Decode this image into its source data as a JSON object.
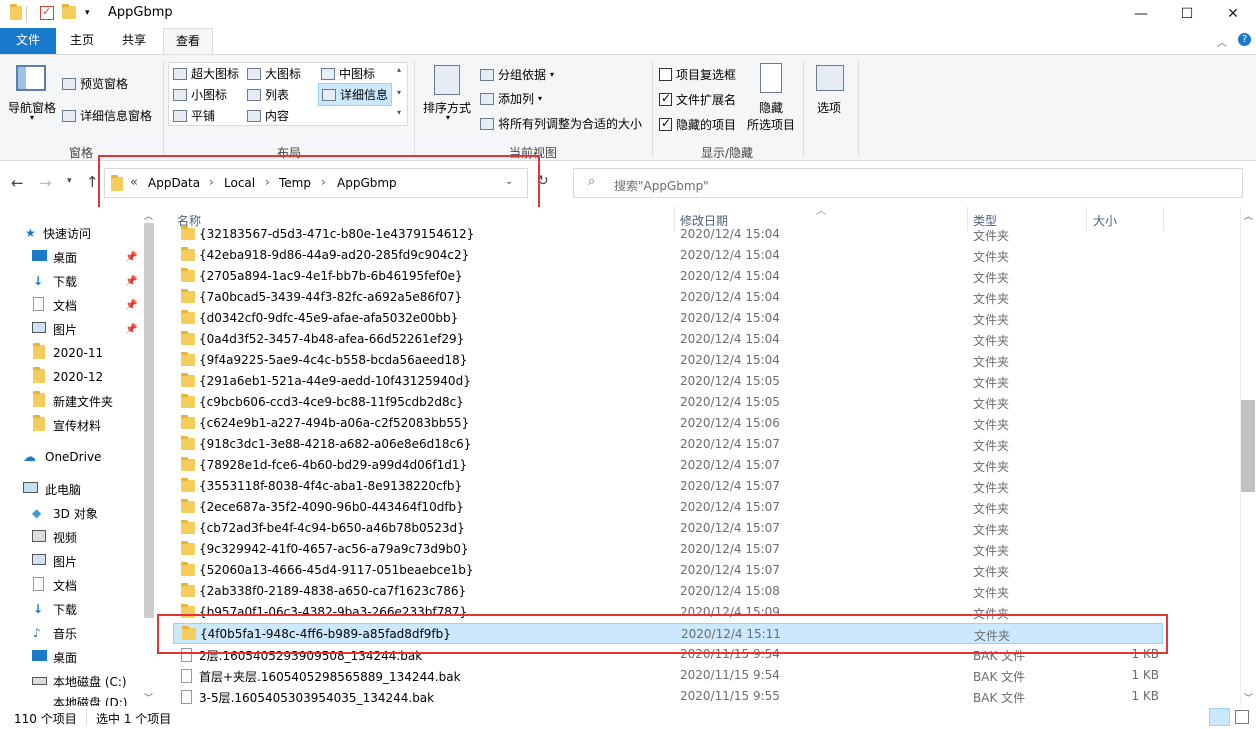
{
  "window": {
    "title": "AppGbmp",
    "minimize": "—",
    "maximize": "☐",
    "close": "✕"
  },
  "tabs": {
    "file": "文件",
    "home": "主页",
    "share": "共享",
    "view": "查看"
  },
  "ribbon": {
    "pane": {
      "nav_pane": "导航窗格",
      "preview": "预览窗格",
      "details": "详细信息窗格",
      "label": "窗格"
    },
    "layout": {
      "xl": "超大图标",
      "large": "大图标",
      "medium": "中图标",
      "small": "小图标",
      "list": "列表",
      "details": "详细信息",
      "tiles": "平铺",
      "content": "内容",
      "label": "布局"
    },
    "current": {
      "sort": "排序方式",
      "group": "分组依据",
      "add_col": "添加列",
      "fit": "将所有列调整为合适的大小",
      "label": "当前视图"
    },
    "showhide": {
      "item_cb": "项目复选框",
      "ext": "文件扩展名",
      "hidden_items": "隐藏的项目",
      "hide": "隐藏",
      "selected": "所选项目",
      "label": "显示/隐藏"
    },
    "options": "选项"
  },
  "address": {
    "chevrons": "«",
    "crumbs": [
      "AppData",
      "Local",
      "Temp",
      "AppGbmp"
    ],
    "search_placeholder": "搜索\"AppGbmp\""
  },
  "nav": {
    "quick": "快速访问",
    "desktop": "桌面",
    "downloads": "下载",
    "docs": "文档",
    "pictures": "图片",
    "f1": "2020-11",
    "f2": "2020-12",
    "f3": "新建文件夹",
    "f4": "宣传材料",
    "onedrive": "OneDrive",
    "pc": "此电脑",
    "obj3d": "3D 对象",
    "videos": "视频",
    "pictures2": "图片",
    "docs2": "文档",
    "downloads2": "下载",
    "music": "音乐",
    "desktop2": "桌面",
    "cdrive": "本地磁盘 (C:)",
    "ddrive": "本地磁盘 (D:)"
  },
  "columns": {
    "name": "名称",
    "date": "修改日期",
    "type": "类型",
    "size": "大小"
  },
  "files": [
    {
      "name": "{32183567-d5d3-471c-b80e-1e4379154612}",
      "date": "2020/12/4 15:04",
      "type": "文件夹",
      "size": "",
      "kind": "folder"
    },
    {
      "name": "{42eba918-9d86-44a9-ad20-285fd9c904c2}",
      "date": "2020/12/4 15:04",
      "type": "文件夹",
      "size": "",
      "kind": "folder"
    },
    {
      "name": "{2705a894-1ac9-4e1f-bb7b-6b46195fef0e}",
      "date": "2020/12/4 15:04",
      "type": "文件夹",
      "size": "",
      "kind": "folder"
    },
    {
      "name": "{7a0bcad5-3439-44f3-82fc-a692a5e86f07}",
      "date": "2020/12/4 15:04",
      "type": "文件夹",
      "size": "",
      "kind": "folder"
    },
    {
      "name": "{d0342cf0-9dfc-45e9-afae-afa5032e00bb}",
      "date": "2020/12/4 15:04",
      "type": "文件夹",
      "size": "",
      "kind": "folder"
    },
    {
      "name": "{0a4d3f52-3457-4b48-afea-66d52261ef29}",
      "date": "2020/12/4 15:04",
      "type": "文件夹",
      "size": "",
      "kind": "folder"
    },
    {
      "name": "{9f4a9225-5ae9-4c4c-b558-bcda56aeed18}",
      "date": "2020/12/4 15:04",
      "type": "文件夹",
      "size": "",
      "kind": "folder"
    },
    {
      "name": "{291a6eb1-521a-44e9-aedd-10f43125940d}",
      "date": "2020/12/4 15:05",
      "type": "文件夹",
      "size": "",
      "kind": "folder"
    },
    {
      "name": "{c9bcb606-ccd3-4ce9-bc88-11f95cdb2d8c}",
      "date": "2020/12/4 15:05",
      "type": "文件夹",
      "size": "",
      "kind": "folder"
    },
    {
      "name": "{c624e9b1-a227-494b-a06a-c2f52083bb55}",
      "date": "2020/12/4 15:06",
      "type": "文件夹",
      "size": "",
      "kind": "folder"
    },
    {
      "name": "{918c3dc1-3e88-4218-a682-a06e8e6d18c6}",
      "date": "2020/12/4 15:07",
      "type": "文件夹",
      "size": "",
      "kind": "folder"
    },
    {
      "name": "{78928e1d-fce6-4b60-bd29-a99d4d06f1d1}",
      "date": "2020/12/4 15:07",
      "type": "文件夹",
      "size": "",
      "kind": "folder"
    },
    {
      "name": "{3553118f-8038-4f4c-aba1-8e9138220cfb}",
      "date": "2020/12/4 15:07",
      "type": "文件夹",
      "size": "",
      "kind": "folder"
    },
    {
      "name": "{2ece687a-35f2-4090-96b0-443464f10dfb}",
      "date": "2020/12/4 15:07",
      "type": "文件夹",
      "size": "",
      "kind": "folder"
    },
    {
      "name": "{cb72ad3f-be4f-4c94-b650-a46b78b0523d}",
      "date": "2020/12/4 15:07",
      "type": "文件夹",
      "size": "",
      "kind": "folder"
    },
    {
      "name": "{9c329942-41f0-4657-ac56-a79a9c73d9b0}",
      "date": "2020/12/4 15:07",
      "type": "文件夹",
      "size": "",
      "kind": "folder"
    },
    {
      "name": "{52060a13-4666-45d4-9117-051beaebce1b}",
      "date": "2020/12/4 15:07",
      "type": "文件夹",
      "size": "",
      "kind": "folder"
    },
    {
      "name": "{2ab338f0-2189-4838-a650-ca7f1623c786}",
      "date": "2020/12/4 15:08",
      "type": "文件夹",
      "size": "",
      "kind": "folder"
    },
    {
      "name": "{b957a0f1-06c3-4382-9ba3-266e233bf787}",
      "date": "2020/12/4 15:09",
      "type": "文件夹",
      "size": "",
      "kind": "folder"
    },
    {
      "name": "{4f0b5fa1-948c-4ff6-b989-a85fad8df9fb}",
      "date": "2020/12/4 15:11",
      "type": "文件夹",
      "size": "",
      "kind": "folder",
      "selected": true
    },
    {
      "name": "2层.1605405293909508_134244.bak",
      "date": "2020/11/15 9:54",
      "type": "BAK 文件",
      "size": "1 KB",
      "kind": "file"
    },
    {
      "name": "首层+夹层.1605405298565889_134244.bak",
      "date": "2020/11/15 9:54",
      "type": "BAK 文件",
      "size": "1 KB",
      "kind": "file"
    },
    {
      "name": "3-5层.1605405303954035_134244.bak",
      "date": "2020/11/15 9:55",
      "type": "BAK 文件",
      "size": "1 KB",
      "kind": "file"
    }
  ],
  "status": {
    "count": "110 个项目",
    "selected": "选中 1 个项目"
  }
}
